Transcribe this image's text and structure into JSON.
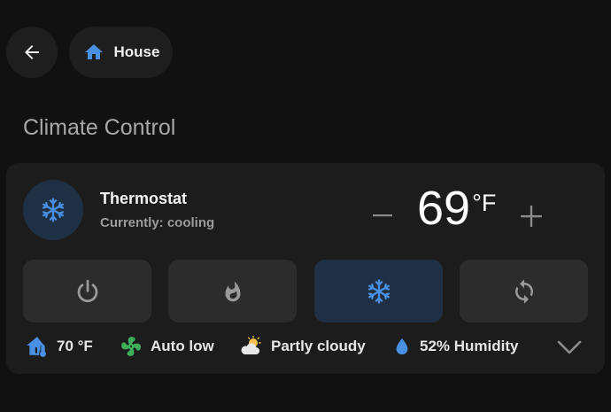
{
  "header": {
    "back_icon": "arrow-left-icon",
    "breadcrumb": {
      "icon": "home-icon",
      "label": "House"
    }
  },
  "section": {
    "title": "Climate Control"
  },
  "thermostat": {
    "name": "Thermostat",
    "status": "Currently: cooling",
    "target_temperature": "69",
    "unit": "°F",
    "decrease_label": "−",
    "increase_label": "+",
    "active_mode": "cool",
    "modes": [
      {
        "id": "off",
        "icon": "power-icon"
      },
      {
        "id": "heat",
        "icon": "flame-icon"
      },
      {
        "id": "cool",
        "icon": "snowflake-icon"
      },
      {
        "id": "heat_cool",
        "icon": "sync-icon"
      }
    ],
    "attributes": [
      {
        "icon": "thermometer-home-icon",
        "label": "70 °F"
      },
      {
        "icon": "fan-icon",
        "label": "Auto low"
      },
      {
        "icon": "partly-cloudy-icon",
        "label": "Partly cloudy"
      },
      {
        "icon": "water-drop-icon",
        "label": "52% Humidity"
      }
    ]
  },
  "colors": {
    "accent": "#4a90e2",
    "fan_green": "#3fae5a",
    "active_bg": "#1f3045",
    "card_bg": "#1c1c1c"
  }
}
